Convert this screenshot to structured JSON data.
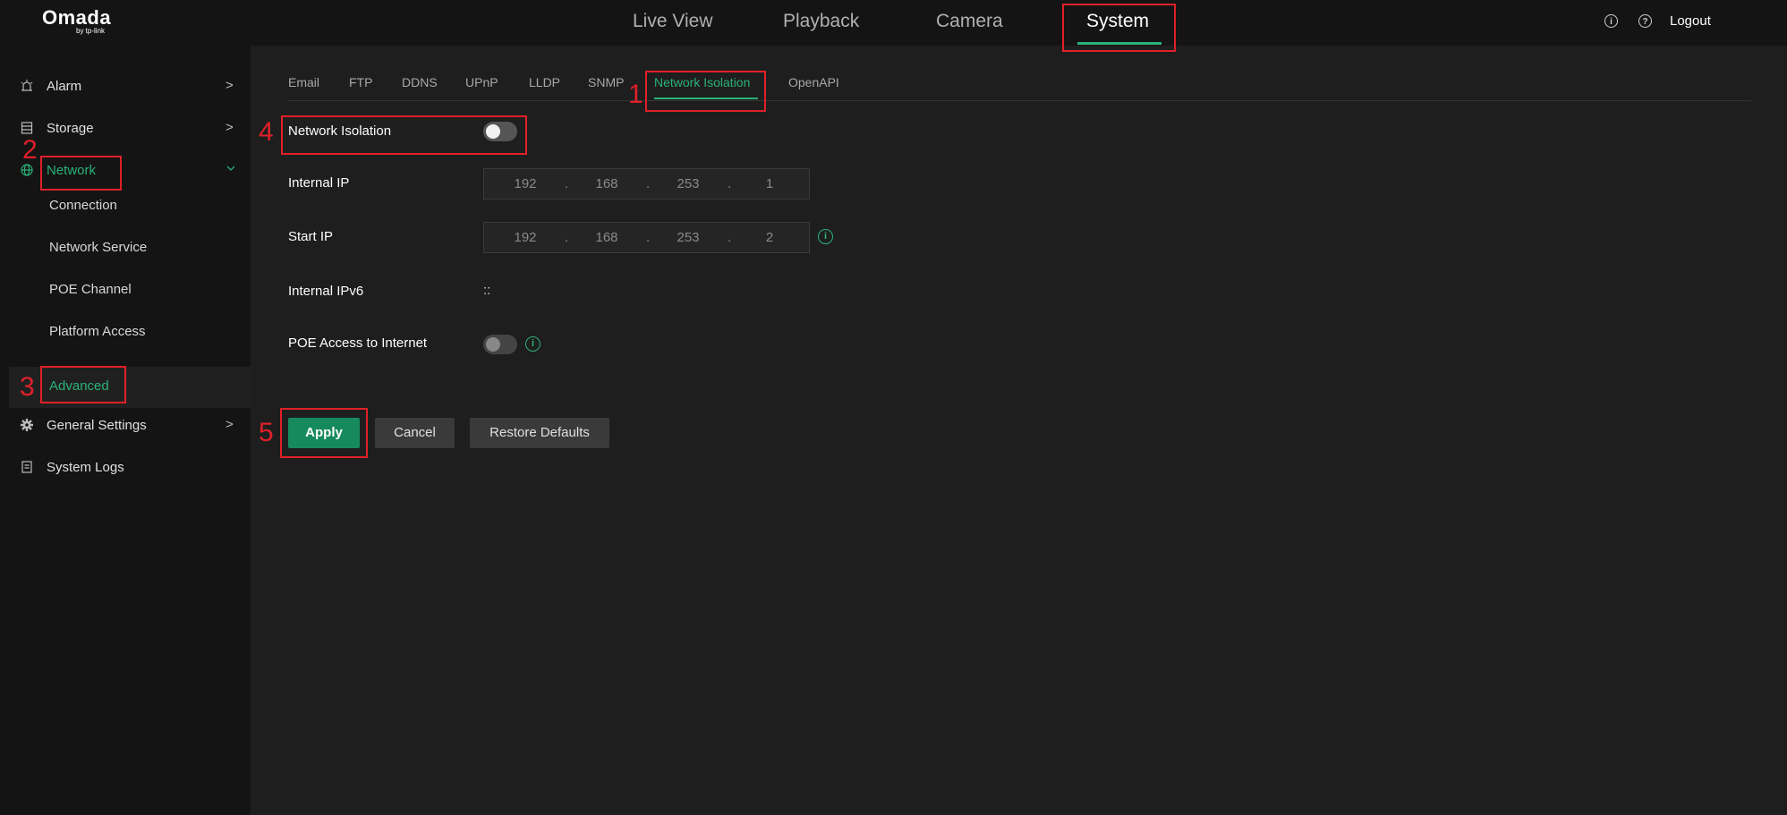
{
  "brand": {
    "name": "Omada",
    "sub": "by tp-link"
  },
  "top_nav": [
    "Live View",
    "Playback",
    "Camera",
    "System"
  ],
  "top_right": {
    "info_icon": "i",
    "help_icon": "?",
    "logout": "Logout"
  },
  "sidebar": {
    "items": [
      {
        "label": "Alarm",
        "icon": "alarm-icon"
      },
      {
        "label": "Storage",
        "icon": "storage-icon"
      },
      {
        "label": "Network",
        "icon": "globe-icon"
      },
      {
        "label": "General Settings",
        "icon": "gear-icon"
      },
      {
        "label": "System Logs",
        "icon": "logs-icon"
      }
    ],
    "network_sub": [
      "Connection",
      "Network Service",
      "POE Channel",
      "Platform Access",
      "Advanced"
    ]
  },
  "subtabs": [
    "Email",
    "FTP",
    "DDNS",
    "UPnP",
    "LLDP",
    "SNMP",
    "Network Isolation",
    "OpenAPI"
  ],
  "form": {
    "network_isolation_label": "Network Isolation",
    "network_isolation_enabled": false,
    "internal_ip_label": "Internal IP",
    "internal_ip": [
      "192",
      "168",
      "253",
      "1"
    ],
    "start_ip_label": "Start IP",
    "start_ip": [
      "192",
      "168",
      "253",
      "2"
    ],
    "internal_ipv6_label": "Internal IPv6",
    "internal_ipv6_value": "::",
    "poe_access_label": "POE Access to Internet",
    "poe_access_enabled": false,
    "ip_separator": "."
  },
  "buttons": {
    "apply": "Apply",
    "cancel": "Cancel",
    "restore": "Restore Defaults"
  },
  "annotations": [
    "1",
    "2",
    "3",
    "4",
    "5"
  ],
  "colors": {
    "accent": "#2bb27a",
    "highlight": "#e0202a",
    "apply_bg": "#168a5d"
  }
}
